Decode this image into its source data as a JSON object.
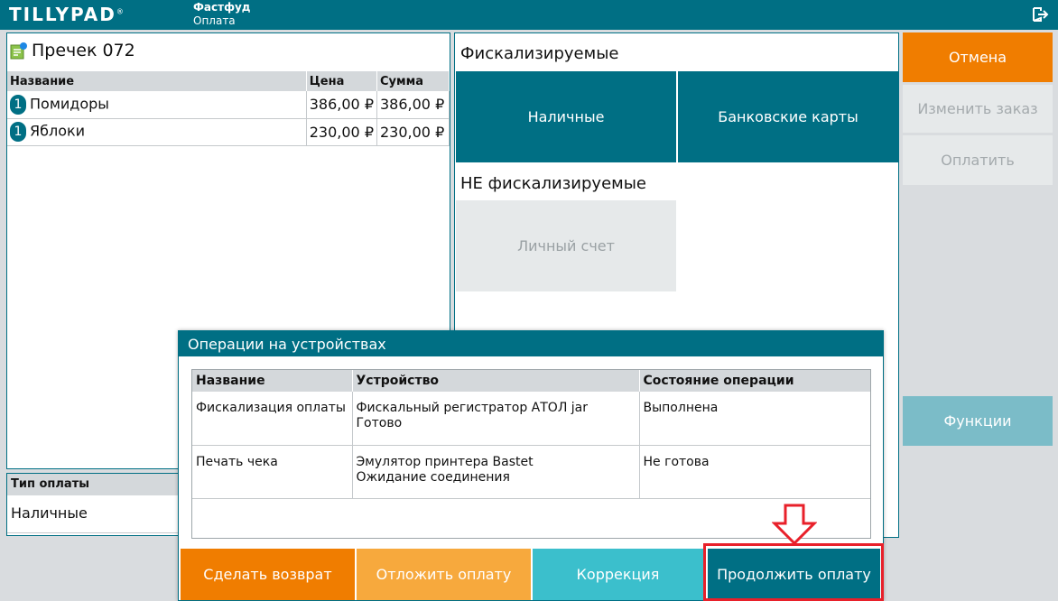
{
  "header": {
    "logo": "TILLYPAD",
    "logo_mark": "®",
    "breadcrumb_primary": "Фастфуд",
    "breadcrumb_secondary": "Оплата",
    "exit_icon": "exit-icon"
  },
  "check": {
    "title": "Пречек 072",
    "columns": [
      "Название",
      "Цена",
      "Сумма"
    ],
    "rows": [
      {
        "qty": "1",
        "name": "Помидоры",
        "price": "386,00 ₽",
        "sum": "386,00 ₽"
      },
      {
        "qty": "1",
        "name": "Яблоки",
        "price": "230,00 ₽",
        "sum": "230,00 ₽"
      }
    ]
  },
  "payment_type": {
    "header": "Тип оплаты",
    "value": "Наличные"
  },
  "payment_methods": {
    "fiscal_title": "Фискализируемые",
    "cash": "Наличные",
    "cards": "Банковские карты",
    "nonfiscal_title": "НЕ фискализируемые",
    "personal_account": "Личный счет"
  },
  "actions": {
    "cancel": "Отмена",
    "edit_order": "Изменить заказ",
    "pay": "Оплатить",
    "functions": "Функции"
  },
  "dialog": {
    "title": "Операции на устройствах",
    "columns": [
      "Название",
      "Устройство",
      "Состояние операции"
    ],
    "rows": [
      {
        "name": "Фискализация оплаты",
        "device": "Фискальный регистратор АТОЛ jar",
        "device_status": "Готово",
        "state": "Выполнена"
      },
      {
        "name": "Печать чека",
        "device": "Эмулятор принтера Bastet",
        "device_status": "Ожидание соединения",
        "state": "Не готова"
      }
    ],
    "buttons": {
      "return": "Сделать возврат",
      "defer": "Отложить оплату",
      "correction": "Коррекция",
      "continue": "Продолжить оплату"
    }
  },
  "colors": {
    "teal": "#006f84",
    "orange": "#f07d00",
    "highlight": "#e8202a"
  }
}
